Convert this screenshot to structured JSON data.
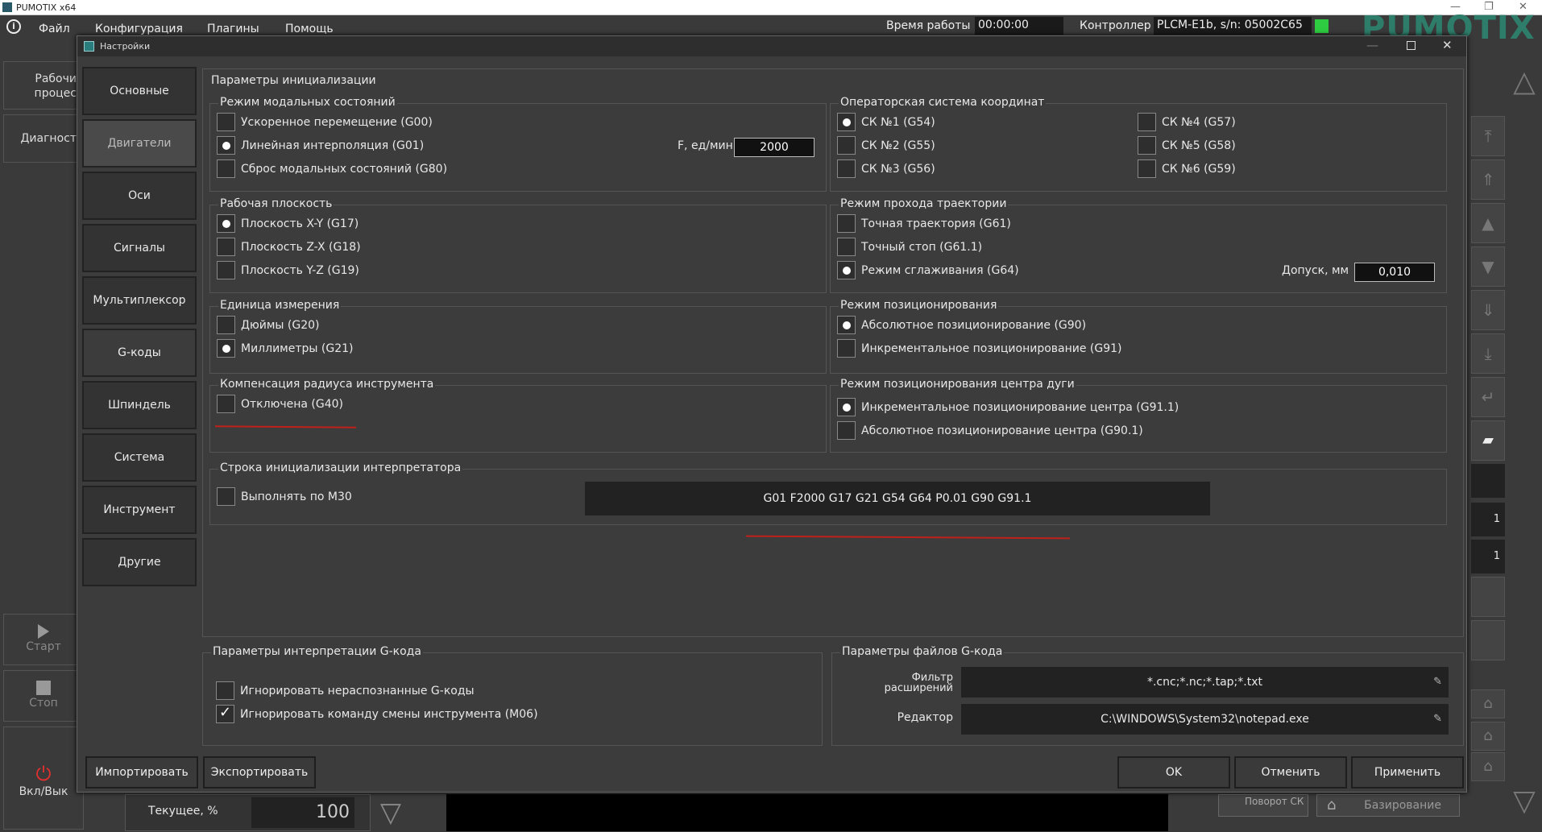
{
  "app": {
    "title": "PUMOTIX x64",
    "brand": "PUMOTIX"
  },
  "menu": [
    "Файл",
    "Конфигурация",
    "Плагины",
    "Помощь"
  ],
  "header": {
    "runtime_label": "Время работы",
    "runtime_value": "00:00:00",
    "controller_label": "Контроллер",
    "controller_value": "PLCM-E1b, s/n: 05002C65"
  },
  "left_panel": {
    "work_label": "Рабочи процес",
    "diag_label": "Диагност",
    "start_label": "Старт",
    "stop_label": "Стоп",
    "power_label": "Вкл/Вык"
  },
  "bottom_bar": {
    "current_label": "Текущее, %",
    "current_value": "100",
    "rotate_label": "Поворот СК",
    "home_label": "Базирование"
  },
  "right_panel": {
    "val1": "1",
    "val2": "1"
  },
  "dialog": {
    "title": "Настройки",
    "tabs": [
      "Основные",
      "Двигатели",
      "Оси",
      "Сигналы",
      "Мультиплексор",
      "G-коды",
      "Шпиндель",
      "Система",
      "Инструмент",
      "Другие"
    ],
    "init_title": "Параметры инициализации",
    "modal": {
      "title": "Режим модальных состояний",
      "g00": "Ускоренное перемещение (G00)",
      "g01": "Линейная интерполяция (G01)",
      "g80": "Сброс модальных состояний (G80)",
      "feed_label": "F, ед/мин",
      "feed_value": "2000"
    },
    "coord": {
      "title": "Операторская система координат",
      "g54": "СК №1 (G54)",
      "g55": "СК №2 (G55)",
      "g56": "СК №3 (G56)",
      "g57": "СК №4 (G57)",
      "g58": "СК №5 (G58)",
      "g59": "СК №6 (G59)"
    },
    "plane": {
      "title": "Рабочая плоскость",
      "g17": "Плоскость X-Y (G17)",
      "g18": "Плоскость Z-X (G18)",
      "g19": "Плоскость Y-Z (G19)"
    },
    "path": {
      "title": "Режим прохода траектории",
      "g61": "Точная траектория (G61)",
      "g611": "Точный стоп (G61.1)",
      "g64": "Режим сглаживания (G64)",
      "tol_label": "Допуск, мм",
      "tol_value": "0,010"
    },
    "units": {
      "title": "Единица измерения",
      "g20": "Дюймы (G20)",
      "g21": "Миллиметры (G21)"
    },
    "positioning": {
      "title": "Режим позиционирования",
      "g90": "Абсолютное позиционирование (G90)",
      "g91": "Инкрементальное позиционирование (G91)"
    },
    "radius": {
      "title": "Компенсация радиуса инструмента",
      "g40": "Отключена (G40)"
    },
    "arc": {
      "title": "Режим позиционирования центра дуги",
      "g911": "Инкрементальное позиционирование центра (G91.1)",
      "g901": "Абсолютное позиционирование центра (G90.1)"
    },
    "initstr": {
      "title": "Строка инициализации интерпретатора",
      "m30": "Выполнять по M30",
      "value": "G01 F2000 G17 G21 G54 G64 P0.01 G90 G91.1"
    },
    "interp": {
      "title": "Параметры интерпретации G-кода",
      "ignore_unknown": "Игнорировать нераспознанные G-коды",
      "ignore_m06": "Игнорировать команду смены инструмента (M06)"
    },
    "files": {
      "title": "Параметры файлов G-кода",
      "filter_label1": "Фильтр",
      "filter_label2": "расширений",
      "filter_value": "*.cnc;*.nc;*.tap;*.txt",
      "editor_label": "Редактор",
      "editor_value": "C:\\WINDOWS\\System32\\notepad.exe"
    },
    "buttons": {
      "import": "Импортировать",
      "export": "Экспортировать",
      "ok": "OK",
      "cancel": "Отменить",
      "apply": "Применить"
    }
  }
}
